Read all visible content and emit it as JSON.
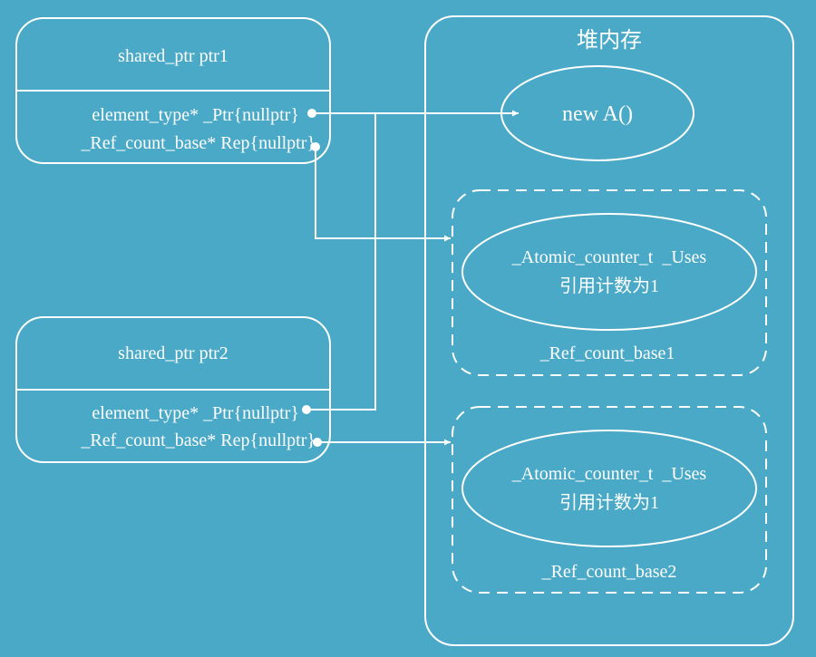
{
  "colors": {
    "background": "#4aa9c6",
    "stroke": "#ffffff"
  },
  "ptr1": {
    "title": "shared_ptr ptr1",
    "field_ptr": "element_type* _Ptr{nullptr}",
    "field_rep": "_Ref_count_base* Rep{nullptr}"
  },
  "ptr2": {
    "title": "shared_ptr ptr2",
    "field_ptr": "element_type* _Ptr{nullptr}",
    "field_rep": "_Ref_count_base* Rep{nullptr}"
  },
  "heap": {
    "title": "堆内存",
    "object_label": "new A()",
    "ref_count_1": {
      "counter_label": "_Atomic_counter_t  _Uses",
      "count_text": "引用计数为1",
      "name": "_Ref_count_base1"
    },
    "ref_count_2": {
      "counter_label": "_Atomic_counter_t  _Uses",
      "count_text": "引用计数为1",
      "name": "_Ref_count_base2"
    }
  }
}
